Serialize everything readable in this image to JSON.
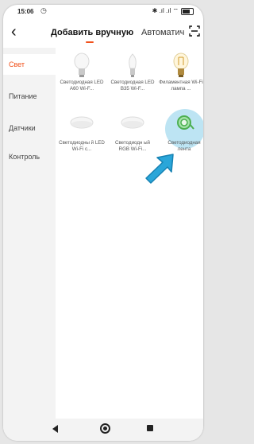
{
  "status_bar": {
    "time": "15:06",
    "alarm_icon": "alarm-icon",
    "system_icons": "✱ .ıl .ıl ⌔"
  },
  "header": {
    "back_icon": "back-arrow-icon",
    "tab_manual": "Добавить вручную",
    "tab_auto": "Автоматич",
    "scan_icon": "scan-icon"
  },
  "sidebar": {
    "items": [
      {
        "label": "Свет",
        "active": true
      },
      {
        "label": "Питание",
        "active": false
      },
      {
        "label": "Датчики",
        "active": false
      },
      {
        "label": "Контроль",
        "active": false
      }
    ]
  },
  "products": [
    {
      "label": "Светодиодная LED A60 Wi-F...",
      "icon": "bulb-a60-icon"
    },
    {
      "label": "Светодиодная LED B35 Wi-F...",
      "icon": "bulb-b35-icon"
    },
    {
      "label": "Филаментная Wi-Fi лампа ...",
      "icon": "filament-bulb-icon"
    },
    {
      "label": "Светодиодны й LED Wi-Fi с...",
      "icon": "ceiling-light-icon"
    },
    {
      "label": "Светодиодн ый RGB Wi-Fi...",
      "icon": "rgb-ceiling-light-icon"
    },
    {
      "label": "Светодиодная лента",
      "icon": "led-strip-icon",
      "highlighted": true
    }
  ],
  "colors": {
    "accent": "#f1511b",
    "highlight": "#bde4f3",
    "arrow": "#2aa6d9"
  },
  "navbar": {
    "back": "nav-back-icon",
    "home": "nav-home-icon",
    "recent": "nav-recent-icon"
  }
}
